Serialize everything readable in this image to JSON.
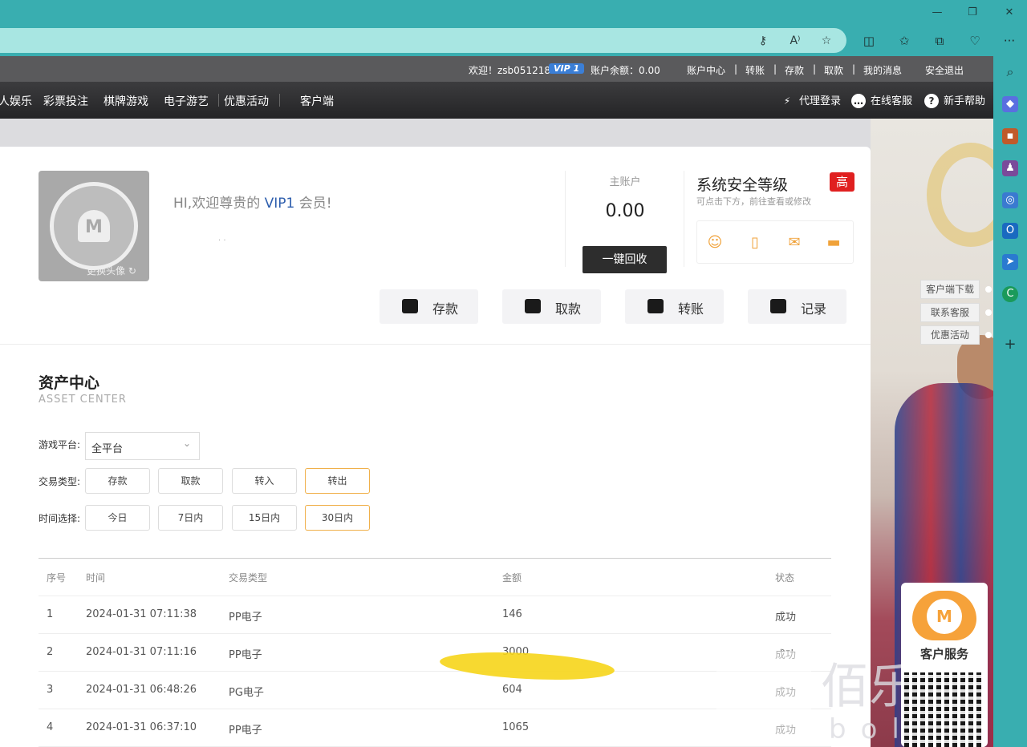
{
  "browser": {
    "window_controls": [
      "—",
      "❐",
      "✕"
    ],
    "toolbar_icons": [
      "split-screen-icon",
      "favorites-icon",
      "collections-icon",
      "extensions-icon",
      "more-icon"
    ],
    "address_icons": [
      "key-icon",
      "read-aloud-icon",
      "star-icon"
    ],
    "read_aloud_glyph": "A⁾",
    "more_glyph": "···"
  },
  "site_topbar": {
    "welcome": "欢迎！zsb051218",
    "vip_badge": "VIP 1",
    "balance": "账户余额：0.00",
    "links": [
      "账户中心",
      "|",
      "转账",
      "|",
      "存款",
      "|",
      "取款",
      "|",
      "我的消息"
    ],
    "logout": "安全退出"
  },
  "navbar": {
    "items": [
      "人娱乐",
      "彩票投注",
      "棋牌游戏",
      "电子游艺",
      "优惠活动",
      "客户端"
    ],
    "right": [
      {
        "icon": "lightning-icon",
        "glyph": "⚡",
        "label": "代理登录"
      },
      {
        "icon": "chat-icon",
        "glyph": "…",
        "label": "在线客服"
      },
      {
        "icon": "help-icon",
        "glyph": "?",
        "label": "新手帮助"
      }
    ]
  },
  "profile": {
    "avatar_change": "更换头像 ↻",
    "greeting_prefix": "HI,欢迎尊贵的 ",
    "greeting_vip": "VIP1",
    "greeting_suffix": " 会员!",
    "dots": "·  ·",
    "main_account_label": "主账户",
    "main_account_value": "0.00",
    "recycle_button": "一键回收",
    "security_title": "系统安全等级",
    "security_level": "高",
    "security_hint": "可点击下方，前往查看或修改",
    "security_icons": [
      "user-card-icon",
      "phone-icon",
      "mail-icon",
      "bank-card-icon"
    ]
  },
  "actions": [
    {
      "label": "存款",
      "icon": "wallet-icon"
    },
    {
      "label": "取款",
      "icon": "withdraw-card-icon"
    },
    {
      "label": "转账",
      "icon": "transfer-icon"
    },
    {
      "label": "记录",
      "icon": "record-icon"
    }
  ],
  "asset_center": {
    "title": "资产中心",
    "subtitle": "ASSET CENTER",
    "platform_label": "游戏平台:",
    "platform_value": "全平台",
    "type_label": "交易类型:",
    "types": [
      "存款",
      "取款",
      "转入",
      "转出"
    ],
    "active_type": "转出",
    "time_label": "时间选择:",
    "times": [
      "今日",
      "7日内",
      "15日内",
      "30日内"
    ],
    "active_time": "30日内"
  },
  "table": {
    "headers": [
      "序号",
      "时间",
      "交易类型",
      "金额",
      "状态"
    ],
    "rows": [
      [
        "1",
        "2024-01-31 07:11:38",
        "PP电子",
        "146",
        "成功"
      ],
      [
        "2",
        "2024-01-31 07:11:16",
        "PP电子",
        "3000",
        "成功"
      ],
      [
        "3",
        "2024-01-31 06:48:26",
        "PG电子",
        "604",
        "成功"
      ],
      [
        "4",
        "2024-01-31 06:37:10",
        "PP电子",
        "1065",
        "成功"
      ]
    ]
  },
  "float_links": [
    "客户端下载",
    "联系客服",
    "优惠活动"
  ],
  "customer_service": {
    "label": "客户服务"
  },
  "watermark": {
    "text": "佰乐",
    "sub": "bolem"
  },
  "colors": {
    "browser_teal": "#39aeb0",
    "nav_dark": "#2d2d2f",
    "vip_blue": "#3b7fd7",
    "badge_red": "#e02020",
    "active_border": "#f0b04a",
    "icon_orange": "#f0a23a"
  }
}
